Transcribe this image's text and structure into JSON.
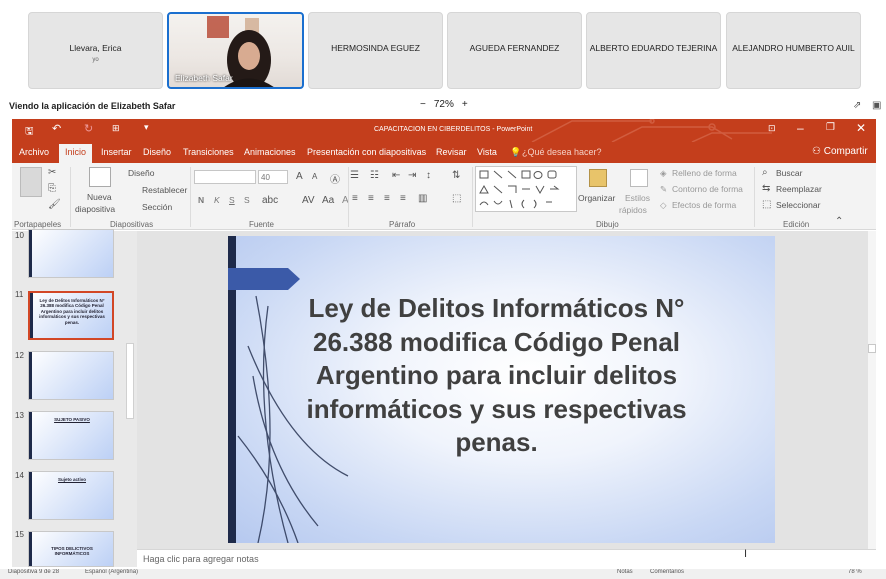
{
  "participants": [
    {
      "name": "Llevara, Erica",
      "sub": "yo"
    },
    {
      "name": "Elizabeth Safar"
    },
    {
      "name": "HERMOSINDA EGUEZ"
    },
    {
      "name": "AGUEDA FERNANDEZ"
    },
    {
      "name": "ALBERTO EDUARDO TEJERINA"
    },
    {
      "name": "ALEJANDRO HUMBERTO AUIL"
    }
  ],
  "share": {
    "title": "Viendo la aplicación de Elizabeth Safar",
    "zoom": "72%",
    "minus": "−",
    "plus": "+"
  },
  "app": {
    "title": "CAPACITACION EN CIBERDELITOS - PowerPoint"
  },
  "tabs": [
    "Archivo",
    "Inicio",
    "Insertar",
    "Diseño",
    "Transiciones",
    "Animaciones",
    "Presentación con diapositivas",
    "Revisar",
    "Vista"
  ],
  "tell_me": "¿Qué desea hacer?",
  "share_button": "Compartir",
  "ribbon": {
    "groups": [
      "Portapapeles",
      "Diapositivas",
      "Fuente",
      "Párrafo",
      "Dibujo",
      "Edición"
    ],
    "nueva": "Nueva",
    "diapositiva": "diapositiva",
    "diseno": "Diseño",
    "restablecer": "Restablecer",
    "seccion": "Sección",
    "font_size": "40",
    "bold": "N",
    "italic": "K",
    "underline": "S",
    "strike": "S",
    "organizar": "Organizar",
    "estilos": "Estilos",
    "rapidos": "rápidos",
    "relleno": "Relleno de forma",
    "contorno": "Contorno de forma",
    "efectos": "Efectos de forma",
    "buscar": "Buscar",
    "reemplazar": "Reemplazar",
    "seleccionar": "Seleccionar"
  },
  "thumbnails": [
    {
      "num": "10",
      "text": "",
      "selected": false
    },
    {
      "num": "11",
      "text": "Ley de Delitos Informáticos N° 26.388 modifica Código Penal Argentino para incluir delitos informáticos y sus respectivas penas.",
      "selected": true
    },
    {
      "num": "12",
      "text": "",
      "selected": false
    },
    {
      "num": "13",
      "text": "SUJETO PASIVO",
      "selected": false
    },
    {
      "num": "14",
      "text": "Sujeto activo",
      "selected": false
    },
    {
      "num": "15",
      "text": "TIPOS DELICTIVOS INFORMÁTICOS",
      "selected": false
    }
  ],
  "slide": {
    "title": "Ley de Delitos Informáticos N° 26.388 modifica Código Penal Argentino para incluir delitos informáticos y sus respectivas penas."
  },
  "notes_placeholder": "Haga clic para agregar notas",
  "status": {
    "left": "Diapositiva 9 de 28",
    "language": "Español (Argentina)",
    "notes": "Notas",
    "comments": "Comentarios",
    "zoom": "78 %"
  }
}
